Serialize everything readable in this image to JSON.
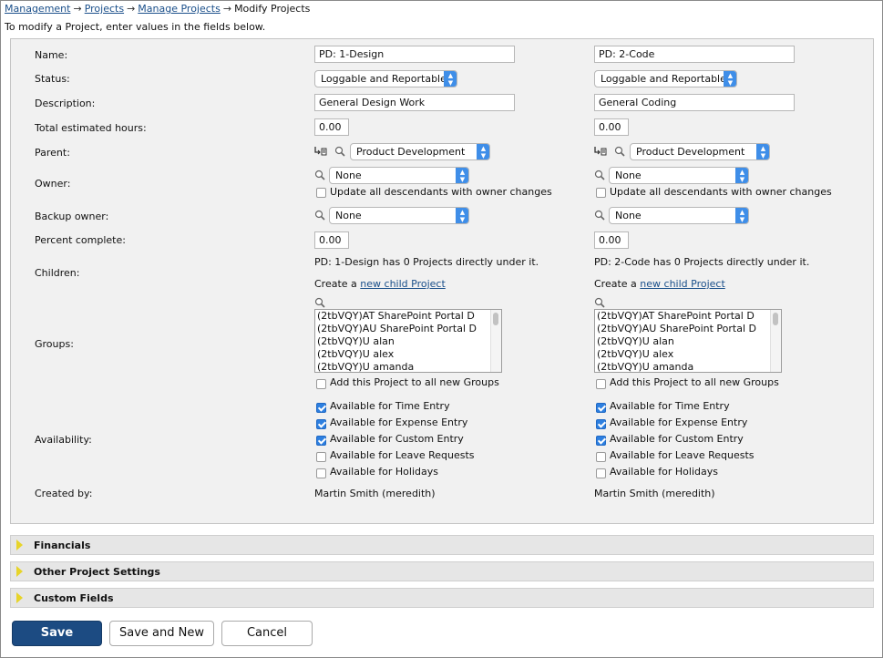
{
  "breadcrumb": {
    "items": [
      "Management",
      "Projects",
      "Manage Projects"
    ],
    "separator": "→",
    "current": "Modify Projects"
  },
  "intro": "To modify a Project, enter values in the fields below.",
  "labels": {
    "name": "Name:",
    "status": "Status:",
    "description": "Description:",
    "total_hours": "Total estimated hours:",
    "parent": "Parent:",
    "owner": "Owner:",
    "backup_owner": "Backup owner:",
    "percent_complete": "Percent complete:",
    "children": "Children:",
    "groups": "Groups:",
    "availability": "Availability:",
    "created_by": "Created by:"
  },
  "common": {
    "update_descendants": "Update all descendants with owner changes",
    "create_a": "Create a",
    "new_child_link": "new child Project",
    "add_to_groups": "Add this Project to all new Groups",
    "groups_list": [
      "(2tbVQY)AT SharePoint Portal D",
      "(2tbVQY)AU SharePoint Portal D",
      "(2tbVQY)U alan",
      "(2tbVQY)U alex",
      "(2tbVQY)U amanda"
    ],
    "availability_options": [
      "Available for Time Entry",
      "Available for Expense Entry",
      "Available for Custom Entry",
      "Available for Leave Requests",
      "Available for Holidays"
    ]
  },
  "projects": [
    {
      "name": "PD:  1-Design",
      "status": "Loggable and Reportable",
      "description": "General Design Work",
      "total_hours": "0.00",
      "parent": "Product Development",
      "owner": "None",
      "update_descendants_checked": false,
      "backup_owner": "None",
      "percent_complete": "0.00",
      "children_text": "PD: 1-Design has 0 Projects directly under it.",
      "add_to_groups_checked": false,
      "availability_checked": [
        true,
        true,
        true,
        false,
        false
      ],
      "created_by": "Martin Smith (meredith)"
    },
    {
      "name": "PD:  2-Code",
      "status": "Loggable and Reportable",
      "description": "General Coding",
      "total_hours": "0.00",
      "parent": "Product Development",
      "owner": "None",
      "update_descendants_checked": false,
      "backup_owner": "None",
      "percent_complete": "0.00",
      "children_text": "PD: 2-Code has 0 Projects directly under it.",
      "add_to_groups_checked": false,
      "availability_checked": [
        true,
        true,
        true,
        false,
        false
      ],
      "created_by": "Martin Smith (meredith)"
    }
  ],
  "sections": [
    "Financials",
    "Other Project Settings",
    "Custom Fields"
  ],
  "buttons": {
    "save": "Save",
    "save_and_new": "Save and New",
    "cancel": "Cancel"
  },
  "colors": {
    "primary_button": "#1c4b82",
    "link": "#1a4f8a",
    "select_arrow": "#3f8ee8",
    "checkbox_on": "#2d7fe0"
  }
}
